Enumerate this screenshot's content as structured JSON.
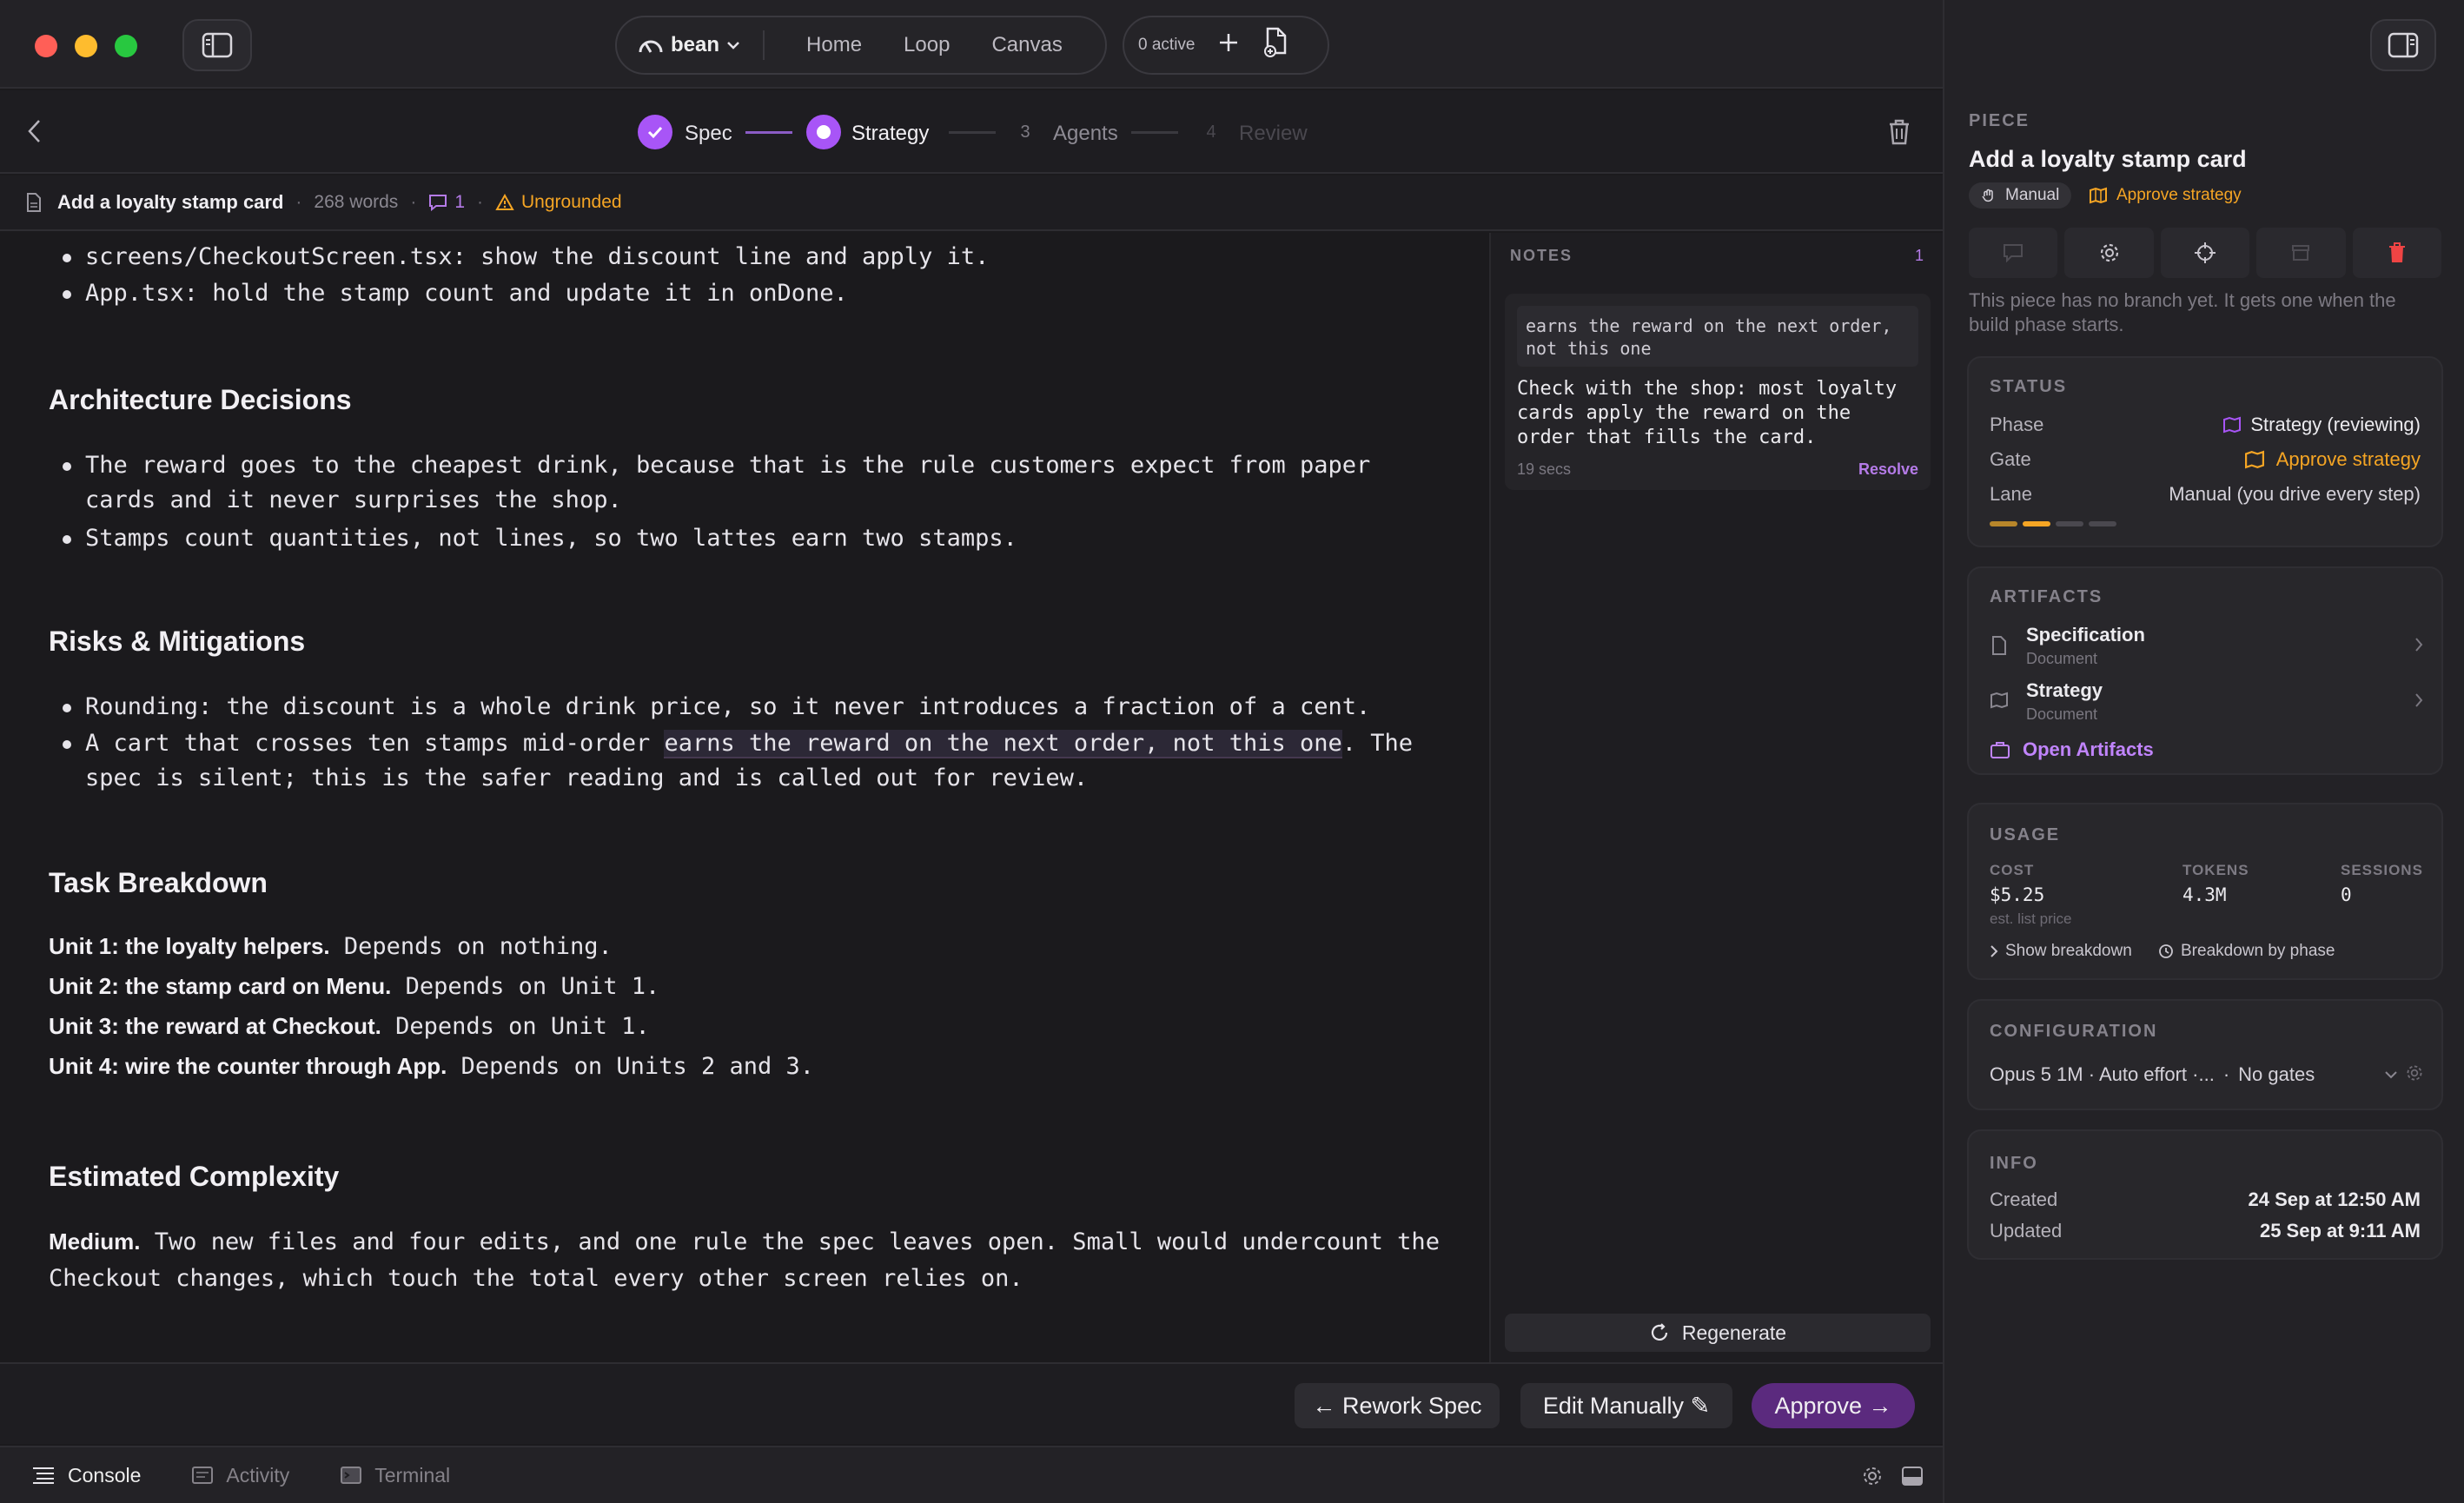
{
  "topbar": {
    "project_name": "bean",
    "nav": [
      "Home",
      "Loop",
      "Canvas"
    ],
    "active_count": "0 active"
  },
  "steps": [
    {
      "num": "1",
      "label": "Spec",
      "state": "done"
    },
    {
      "num": "2",
      "label": "Strategy",
      "state": "current"
    },
    {
      "num": "3",
      "label": "Agents",
      "state": "upcoming"
    },
    {
      "num": "4",
      "label": "Review",
      "state": "disabled"
    }
  ],
  "docbar": {
    "title": "Add a loyalty stamp card",
    "words": "268 words",
    "comments": "1",
    "status": "Ungrounded"
  },
  "doc": {
    "bullets_top": [
      "screens/CheckoutScreen.tsx: show the discount line and apply it.",
      "App.tsx: hold the stamp count and update it in onDone."
    ],
    "arch_title": "Architecture Decisions",
    "arch_bullets": [
      "The reward goes to the cheapest drink, because that is the rule customers expect from paper",
      "cards and it never surprises the shop.",
      "Stamps count quantities, not lines, so two lattes earn two stamps."
    ],
    "risks_title": "Risks & Mitigations",
    "risk1": "Rounding: the discount is a whole drink price, so it never introduces a fraction of a cent.",
    "risk2_pre": "A cart that crosses ten stamps mid-order ",
    "risk2_hl": "earns the reward on the next order, not this one",
    "risk2_post": ". The",
    "risk2_line2": "spec is silent; this is the safer reading and is called out for review.",
    "task_title": "Task Breakdown",
    "units": [
      {
        "name": "Unit 1: the loyalty helpers.",
        "dep": " Depends on nothing."
      },
      {
        "name": "Unit 2: the stamp card on Menu.",
        "dep": " Depends on Unit 1."
      },
      {
        "name": "Unit 3: the reward at Checkout.",
        "dep": " Depends on Unit 1."
      },
      {
        "name": "Unit 4: wire the counter through App.",
        "dep": " Depends on Units 2 and 3."
      }
    ],
    "complexity_title": "Estimated Complexity",
    "complexity_bold": "Medium.",
    "complexity_line1": " Two new files and four edits, and one rule the spec leaves open. Small would undercount the",
    "complexity_line2": "Checkout changes, which touch the total every other screen relies on."
  },
  "notes": {
    "label": "NOTES",
    "count": "1",
    "quote_line1": "earns the reward on the next order,",
    "quote_line2": "not this one",
    "body_lines": [
      "Check with the shop: most loyalty",
      "cards apply the reward on the",
      "order that fills the card."
    ],
    "time": "19 secs",
    "resolve": "Resolve",
    "regenerate": "Regenerate"
  },
  "actions": {
    "rework": "← Rework Spec",
    "edit": "Edit Manually ✎",
    "approve": "Approve →"
  },
  "console": {
    "tabs": [
      "Console",
      "Activity",
      "Terminal"
    ]
  },
  "panel": {
    "label": "PIECE",
    "title": "Add a loyalty stamp card",
    "badge_lane": "Manual",
    "badge_gate": "Approve strategy",
    "branch_note_1": "This piece has no branch yet. It gets one when the",
    "branch_note_2": "build phase starts.",
    "status": {
      "label": "STATUS",
      "phase_key": "Phase",
      "phase_val": "Strategy (reviewing)",
      "gate_key": "Gate",
      "gate_val": "Approve strategy",
      "lane_key": "Lane",
      "lane_val": "Manual (you drive every step)",
      "progress_steps": 4,
      "progress_done": 1,
      "progress_current": 2
    },
    "artifacts": {
      "label": "ARTIFACTS",
      "items": [
        {
          "name": "Specification",
          "type": "Document"
        },
        {
          "name": "Strategy",
          "type": "Document"
        }
      ],
      "open": "Open Artifacts"
    },
    "usage": {
      "label": "USAGE",
      "cost_key": "COST",
      "cost_val": "$5.25",
      "cost_note": "est. list price",
      "tokens_key": "TOKENS",
      "tokens_val": "4.3M",
      "sessions_key": "SESSIONS",
      "sessions_val": "0",
      "show_breakdown": "Show breakdown",
      "by_phase": "Breakdown by phase"
    },
    "configuration": {
      "label": "CONFIGURATION",
      "value": "Opus 5 1M · Auto effort ·...",
      "gates": "No gates"
    },
    "info": {
      "label": "INFO",
      "created_key": "Created",
      "created_val": "24 Sep at 12:50 AM",
      "updated_key": "Updated",
      "updated_val": "25 Sep at 9:11 AM"
    }
  },
  "colors": {
    "accent": "#a855f7",
    "accent_soft": "#c084fc",
    "warning": "#f5a524",
    "danger": "#ef4444",
    "approve_bg": "#5b2a7e"
  }
}
